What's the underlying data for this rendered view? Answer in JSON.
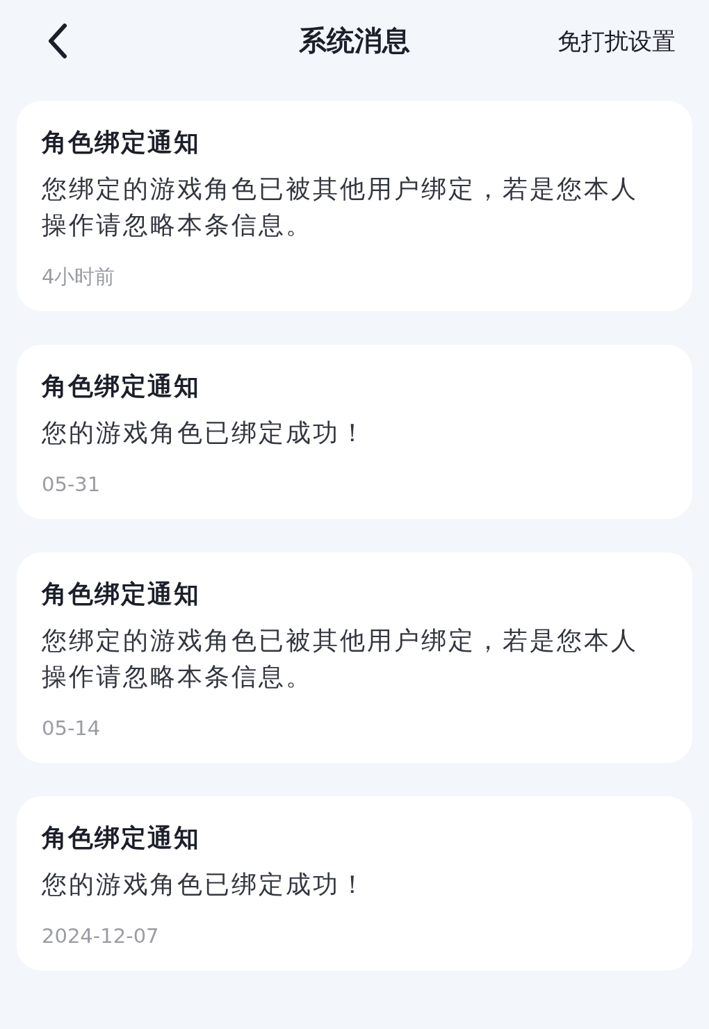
{
  "header": {
    "title": "系统消息",
    "action": "免打扰设置"
  },
  "messages": [
    {
      "title": "角色绑定通知",
      "body": "您绑定的游戏角色已被其他用户绑定，若是您本人操作请忽略本条信息。",
      "time": "4小时前"
    },
    {
      "title": "角色绑定通知",
      "body": "您的游戏角色已绑定成功！",
      "time": "05-31"
    },
    {
      "title": "角色绑定通知",
      "body": "您绑定的游戏角色已被其他用户绑定，若是您本人操作请忽略本条信息。",
      "time": "05-14"
    },
    {
      "title": "角色绑定通知",
      "body": "您的游戏角色已绑定成功！",
      "time": "2024-12-07"
    }
  ]
}
